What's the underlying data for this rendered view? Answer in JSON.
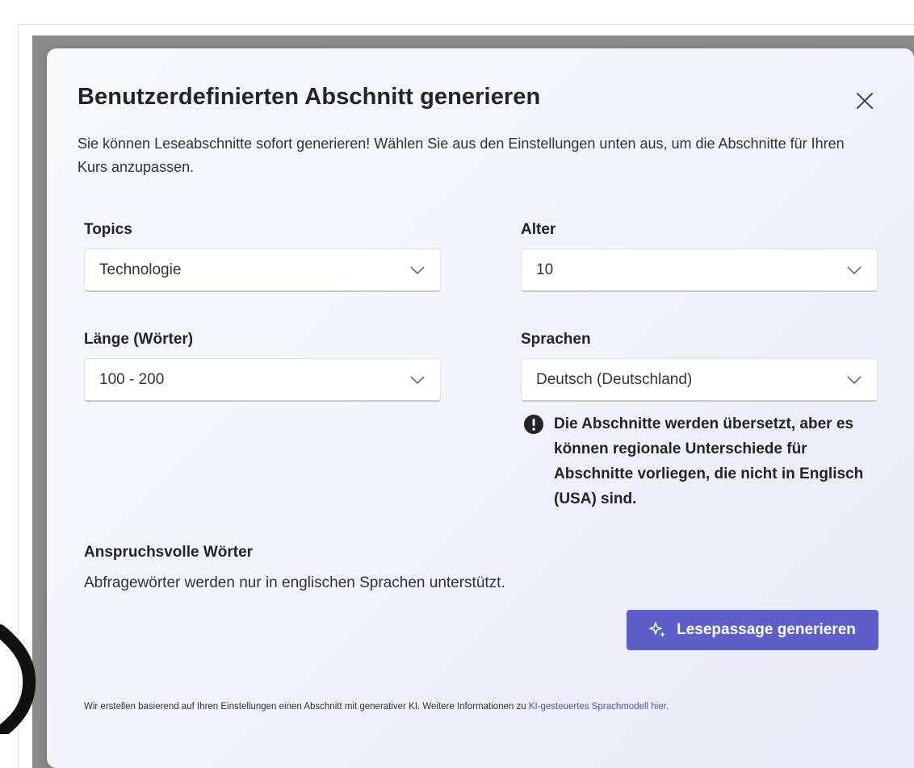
{
  "dialog": {
    "title": "Benutzerdefinierten Abschnitt generieren",
    "close_icon": "close-icon",
    "description": "Sie können Leseabschnitte sofort generieren! Wählen Sie aus den Einstellungen unten aus, um die Abschnitte für Ihren Kurs anzupassen."
  },
  "fields": {
    "topics": {
      "label": "Topics",
      "value": "Technologie"
    },
    "age": {
      "label": "Alter",
      "value": "10"
    },
    "length": {
      "label": "Länge (Wörter)",
      "value": "100 - 200"
    },
    "languages": {
      "label": "Sprachen",
      "value": "Deutsch (Deutschland)"
    }
  },
  "notice": {
    "icon": "info-icon",
    "text": "Die Abschnitte werden übersetzt, aber es können regionale Unterschiede für Abschnitte vorliegen, die nicht in Englisch (USA) sind."
  },
  "challenging_words": {
    "title": "Anspruchsvolle Wörter",
    "text": "Abfragewörter werden nur in englischen Sprachen unterstützt."
  },
  "generate_button": {
    "icon": "sparkle-icon",
    "label": "Lesepassage generieren"
  },
  "footer": {
    "text": "Wir erstellen basierend auf Ihren Einstellungen einen Abschnitt mit generativer KI. Weitere Informationen zu ",
    "link_text": "KI-gesteuertes Sprachmodell hier."
  },
  "colors": {
    "accent": "#5b5fc7",
    "link": "#4f52b2",
    "text": "#242424"
  }
}
